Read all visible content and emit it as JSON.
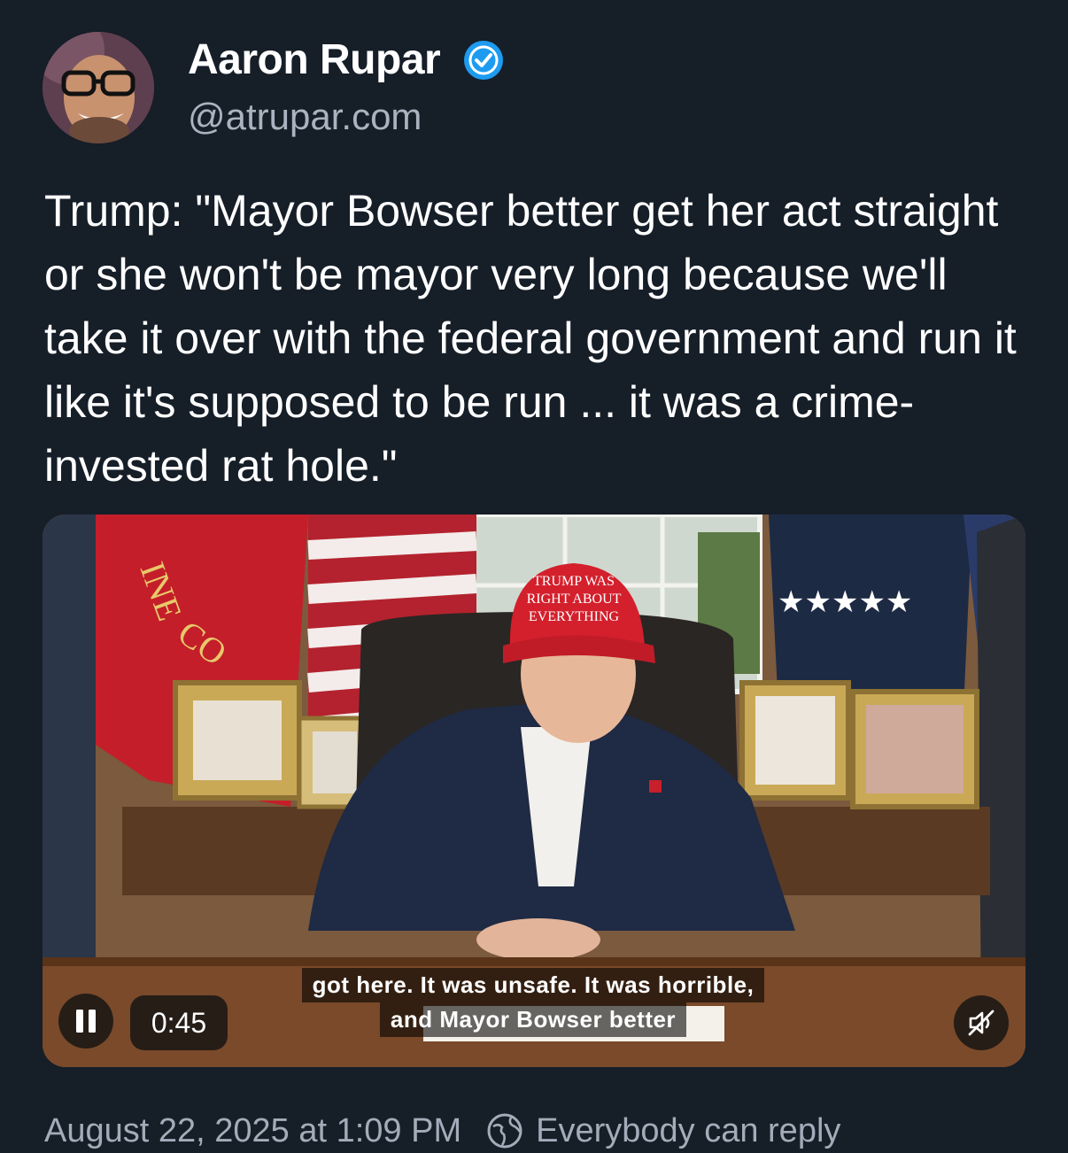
{
  "author": {
    "display_name": "Aaron Rupar",
    "handle": "@atrupar.com",
    "verified_icon": "verified-check-icon",
    "verified_color": "#1d9bf0"
  },
  "post": {
    "text": "Trump: \"Mayor Bowser better get her act straight or she won't be mayor very long because we'll take it over with the federal government and run it like it's supposed to be run ... it was a crime-invested rat hole.\""
  },
  "video": {
    "elapsed_time": "0:45",
    "captions": [
      "got here. It was unsafe. It was horrible,",
      "and Mayor Bowser better"
    ],
    "hat_text": [
      "TRUMP WAS",
      "RIGHT ABOUT",
      "EVERYTHING"
    ],
    "pause_icon": "pause-icon",
    "mute_icon": "speaker-muted-icon"
  },
  "footer": {
    "timestamp": "August 22, 2025 at 1:09 PM",
    "reply_setting": "Everybody can reply",
    "reply_icon": "globe-icon"
  }
}
